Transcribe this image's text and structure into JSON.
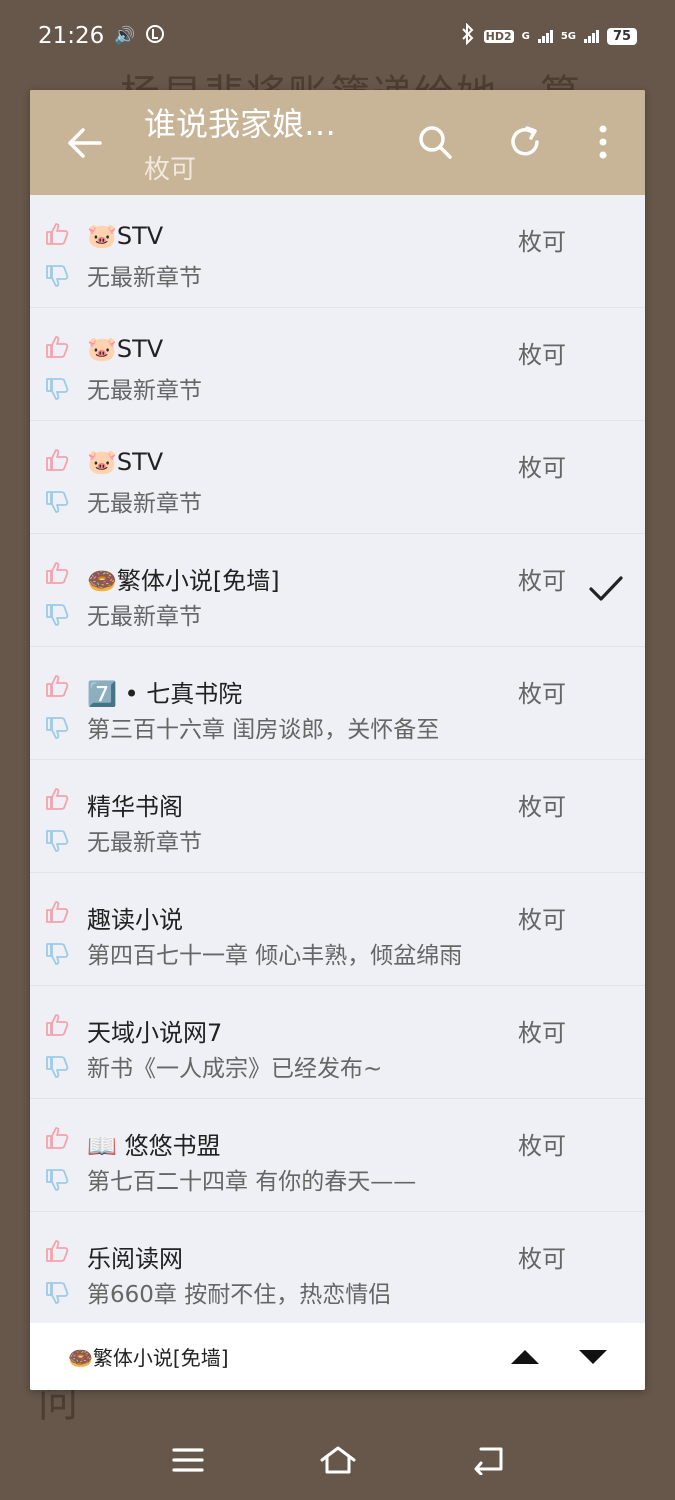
{
  "status": {
    "time": "21:26",
    "hd": "HD2",
    "net_g": "G",
    "net_5g": "5G",
    "battery": "75"
  },
  "background": {
    "line1": "杨显悲将账簿递给她，算",
    "line2": "问"
  },
  "toolbar": {
    "title": "谁说我家娘…",
    "subtitle": "枚可"
  },
  "sources": [
    {
      "name": "🐷STV",
      "chapter": "无最新章节",
      "tag": "枚可",
      "selected": false
    },
    {
      "name": "🐷STV",
      "chapter": "无最新章节",
      "tag": "枚可",
      "selected": false
    },
    {
      "name": "🐷STV",
      "chapter": "无最新章节",
      "tag": "枚可",
      "selected": false
    },
    {
      "name": "🍩繁体小说[免墙]",
      "chapter": "无最新章节",
      "tag": "枚可",
      "selected": true
    },
    {
      "name": "7️⃣ • 七真书院",
      "chapter": "第三百十六章 闺房谈郎，关怀备至",
      "tag": "枚可",
      "selected": false
    },
    {
      "name": "精华书阁",
      "chapter": "无最新章节",
      "tag": "枚可",
      "selected": false
    },
    {
      "name": "趣读小说",
      "chapter": "第四百七十一章 倾心丰熟，倾盆绵雨",
      "tag": "枚可",
      "selected": false
    },
    {
      "name": "天域小说网7",
      "chapter": "新书《一人成宗》已经发布~",
      "tag": "枚可",
      "selected": false
    },
    {
      "name": "📖 悠悠书盟",
      "chapter": "第七百二十四章 有你的春天——",
      "tag": "枚可",
      "selected": false
    },
    {
      "name": "乐阅读网",
      "chapter": "第660章 按耐不住，热恋情侣",
      "tag": "枚可",
      "selected": false
    }
  ],
  "bottom": {
    "current": "🍩繁体小说[免墙]"
  },
  "colors": {
    "toolbar": "#c8b497",
    "thumb_up": "#f4a3ad",
    "thumb_down": "#9ccbe6"
  }
}
